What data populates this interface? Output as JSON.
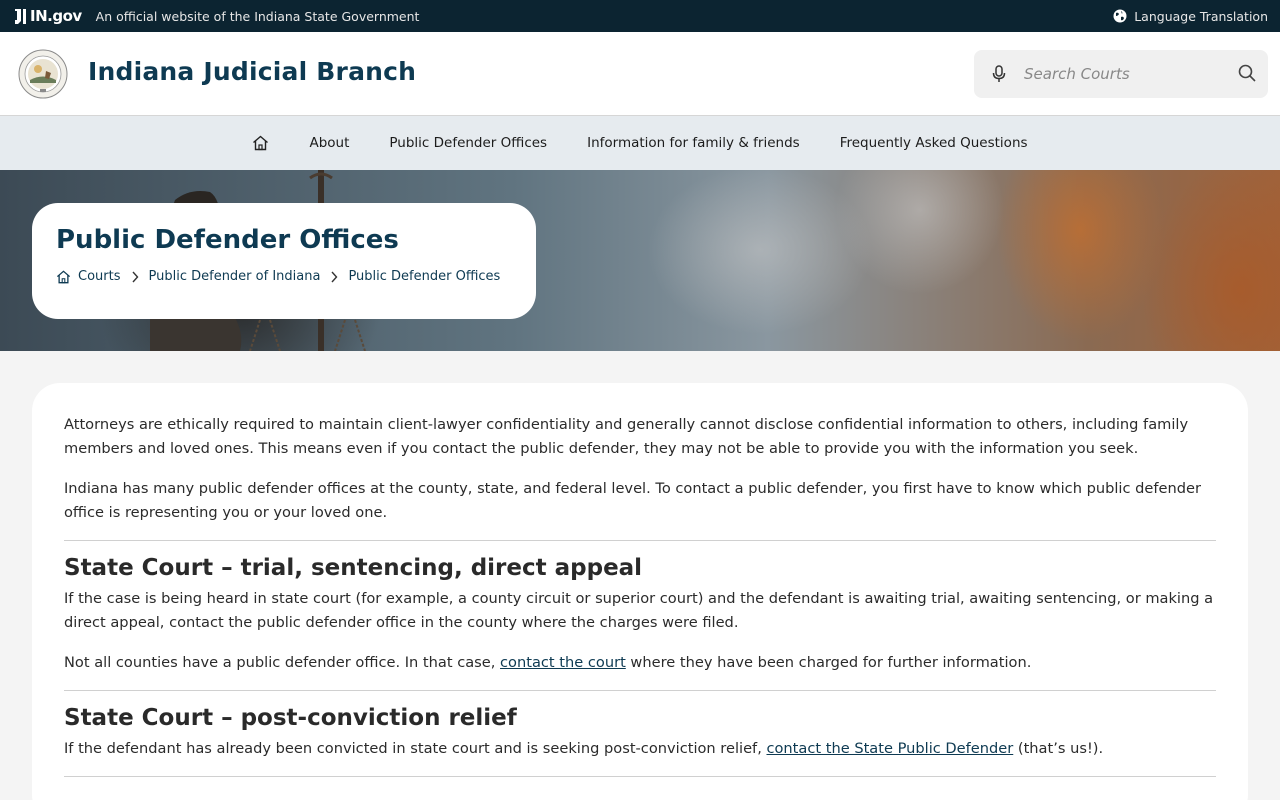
{
  "gov_bar": {
    "logo_text": "IN.gov",
    "official_text": "An official website of the Indiana State Government",
    "language_label": "Language Translation"
  },
  "header": {
    "site_title": "Indiana Judicial Branch",
    "search_placeholder": "Search Courts"
  },
  "nav": {
    "items": [
      {
        "label": "About"
      },
      {
        "label": "Public Defender Offices"
      },
      {
        "label": "Information for family & friends"
      },
      {
        "label": "Frequently Asked Questions"
      }
    ]
  },
  "page": {
    "title": "Public Defender Offices",
    "breadcrumb": [
      "Courts",
      "Public Defender of Indiana",
      "Public Defender Offices"
    ]
  },
  "content": {
    "intro1": "Attorneys are ethically required to maintain client-lawyer confidentiality and generally cannot disclose confidential information to others, including family members and loved ones. This means even if you contact the public defender, they may not be able to provide you with the information you seek.",
    "intro2": "Indiana has many public defender offices at the county, state, and federal level. To contact a public defender, you first have to know which public defender office is representing you or your loved one.",
    "sections": [
      {
        "heading": "State Court – trial, sentencing, direct appeal",
        "p1": "If the case is being heard in state court (for example, a county circuit or superior court) and the defendant is awaiting trial, awaiting sentencing, or making a direct appeal, contact the public defender office in the county where the charges were filed.",
        "p2_before": "Not all counties have a public defender office. In that case, ",
        "p2_link": "contact the court",
        "p2_after": " where they have been charged for further information."
      },
      {
        "heading": "State Court – post-conviction relief",
        "p1_before": "If the defendant has already been convicted in state court and is seeking post-conviction relief, ",
        "p1_link": "contact the State Public Defender",
        "p1_after": " (that’s us!)."
      }
    ]
  },
  "colors": {
    "gov_bar": "#0c2431",
    "brand": "#0e3a52",
    "nav_bg": "#e6ebef",
    "page_bg": "#f4f4f4"
  },
  "icons": [
    "in-gov-logo-icon",
    "globe-icon",
    "state-seal-icon",
    "microphone-icon",
    "search-icon",
    "home-icon",
    "chevron-right-icon"
  ]
}
